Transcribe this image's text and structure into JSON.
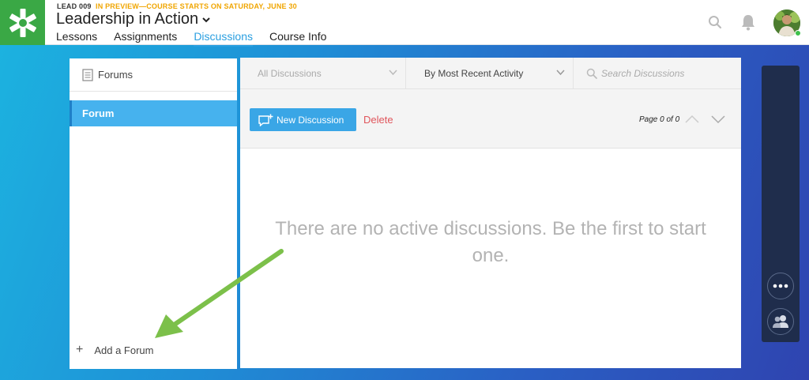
{
  "header": {
    "course_code": "LEAD 009",
    "course_status": "IN PREVIEW—COURSE STARTS ON SATURDAY, JUNE 30",
    "course_title": "Leadership in Action",
    "nav": [
      {
        "label": "Lessons",
        "active": false
      },
      {
        "label": "Assignments",
        "active": false
      },
      {
        "label": "Discussions",
        "active": true
      },
      {
        "label": "Course Info",
        "active": false
      }
    ],
    "icons": [
      "search-icon",
      "bell-icon",
      "avatar"
    ]
  },
  "forums_panel": {
    "title": "Forums",
    "items": [
      {
        "label": "Forum",
        "selected": true
      }
    ],
    "add_label": "Add a Forum"
  },
  "discussions": {
    "filter_placeholder": "All Discussions",
    "sort_label": "By Most Recent Activity",
    "search_placeholder": "Search Discussions",
    "new_button": "New Discussion",
    "delete_button": "Delete",
    "page_info": "Page 0 of 0",
    "empty_message": "There are no active discussions. Be the first to start one."
  },
  "colors": {
    "brand_green": "#3aa845",
    "accent_blue": "#2a9fe0",
    "selected_item": "#46b2ee",
    "delete_red": "#e0555b",
    "status_orange": "#f0a500",
    "annotation_arrow": "#7cc04a"
  }
}
